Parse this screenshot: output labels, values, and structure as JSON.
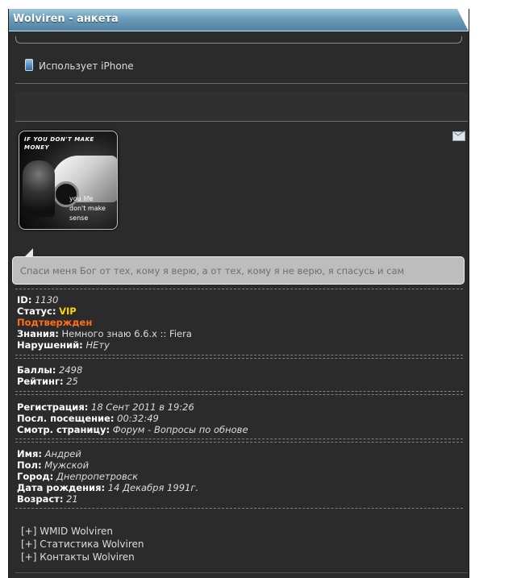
{
  "window": {
    "title": "Wolviren - анкета"
  },
  "device": {
    "icon": "iphone-icon",
    "text": "Использует iPhone"
  },
  "avatar": {
    "top_text": "IF YOU DON'T MAKE\nMONEY",
    "bottom_text": "you life\ndon't make\nsense"
  },
  "message_icon": "envelope-icon",
  "status_message": "Спаси меня Бог от тех, кому я верю, а от тех, кому я не верю, я спасусь и сам",
  "profile": {
    "id_label": "ID:",
    "id_value": "1130",
    "status_label": "Статус:",
    "status_value": "VIP",
    "confirmed": "Подтвержден",
    "knowledge_label": "Знания:",
    "knowledge_value": "Немного знаю 6.6.x :: Fiera",
    "violations_label": "Нарушений:",
    "violations_value": "НЕту"
  },
  "points": {
    "points_label": "Баллы:",
    "points_value": "2498",
    "rating_label": "Рейтинг:",
    "rating_value": "25"
  },
  "activity": {
    "reg_label": "Регистрация:",
    "reg_value": "18 Сент 2011 в 19:26",
    "last_label": "Посл. посещение:",
    "last_value": "00:32:49",
    "viewing_label": "Смотр. страницу:",
    "viewing_value": "Форум - Вопросы по обнове"
  },
  "personal": {
    "name_label": "Имя:",
    "name_value": "Андрей",
    "gender_label": "Пол:",
    "gender_value": "Мужской",
    "city_label": "Город:",
    "city_value": "Днепропетровск",
    "birth_label": "Дата рождения:",
    "birth_value": "14 Декабря 1991г.",
    "age_label": "Возраст:",
    "age_value": "21"
  },
  "links": {
    "wmid": "[+] WMID Wolviren",
    "stats": "[+] Статистика Wolviren",
    "contacts": "[+] Контакты Wolviren"
  },
  "colors": {
    "titlebar": "#5d8fb0",
    "panel_bg": "#2b2b2b",
    "vip": "#ffd400",
    "confirmed": "#ff6f1a",
    "bubble": "#bdbdbd"
  }
}
